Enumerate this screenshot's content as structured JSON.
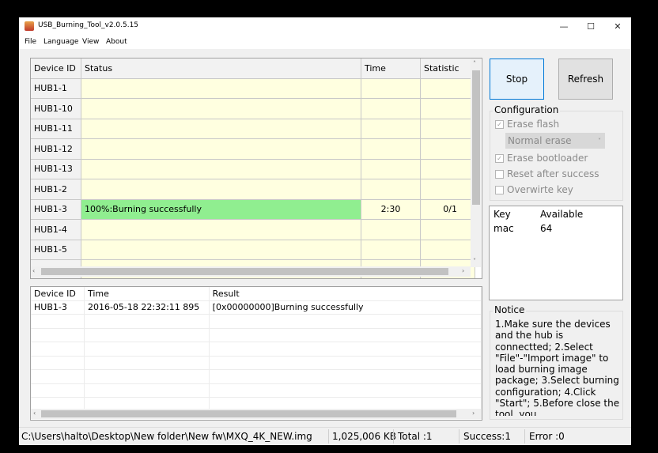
{
  "window": {
    "title": "USB_Burning_Tool_v2.0.5.15",
    "controls": {
      "minimize": "—",
      "maximize": "☐",
      "close": "✕"
    }
  },
  "menu": [
    "File",
    "Language",
    "View",
    "About"
  ],
  "device_grid": {
    "columns": [
      "Device ID",
      "Status",
      "Time",
      "Statistic"
    ],
    "rows": [
      {
        "id": "HUB1-1",
        "status": "",
        "time": "",
        "stat": ""
      },
      {
        "id": "HUB1-10",
        "status": "",
        "time": "",
        "stat": ""
      },
      {
        "id": "HUB1-11",
        "status": "",
        "time": "",
        "stat": ""
      },
      {
        "id": "HUB1-12",
        "status": "",
        "time": "",
        "stat": ""
      },
      {
        "id": "HUB1-13",
        "status": "",
        "time": "",
        "stat": ""
      },
      {
        "id": "HUB1-2",
        "status": "",
        "time": "",
        "stat": ""
      },
      {
        "id": "HUB1-3",
        "status": "100%:Burning successfully",
        "time": "2:30",
        "stat": "0/1"
      },
      {
        "id": "HUB1-4",
        "status": "",
        "time": "",
        "stat": ""
      },
      {
        "id": "HUB1-5",
        "status": "",
        "time": "",
        "stat": ""
      },
      {
        "id": "",
        "status": "",
        "time": "",
        "stat": ""
      }
    ]
  },
  "log": {
    "columns": [
      "Device ID",
      "Time",
      "Result"
    ],
    "rows": [
      {
        "id": "HUB1-3",
        "time": "2016-05-18 22:32:11 895",
        "result": "[0x00000000]Burning successfully"
      }
    ]
  },
  "buttons": {
    "stop": "Stop",
    "refresh": "Refresh"
  },
  "configuration": {
    "label": "Configuration",
    "erase_flash": {
      "label": "Erase flash",
      "checked": true
    },
    "erase_mode": "Normal erase",
    "erase_bootloader": {
      "label": "Erase bootloader",
      "checked": true
    },
    "reset_after_success": {
      "label": "Reset after success",
      "checked": false
    },
    "overwrite_key": {
      "label": "Overwirte key",
      "checked": false
    }
  },
  "keys": {
    "columns": [
      "Key",
      "Available"
    ],
    "rows": [
      {
        "key": "mac",
        "available": "64"
      }
    ]
  },
  "notice": {
    "label": "Notice",
    "text": "1.Make sure the devices and the hub is connectted; 2.Select \"File\"-\"Import image\" to load burning image package; 3.Select burning configuration; 4.Click \"Start\"; 5.Before close the tool, you"
  },
  "status_bar": {
    "path": "C:\\Users\\halto\\Desktop\\New folder\\New fw\\MXQ_4K_NEW.img",
    "size": "1,025,006 KB",
    "total": "Total :1",
    "success": "Success:1",
    "error": "Error :0"
  },
  "colors": {
    "success_row": "#90ee90",
    "pending_row": "#ffffe0",
    "accent": "#0078d7"
  }
}
